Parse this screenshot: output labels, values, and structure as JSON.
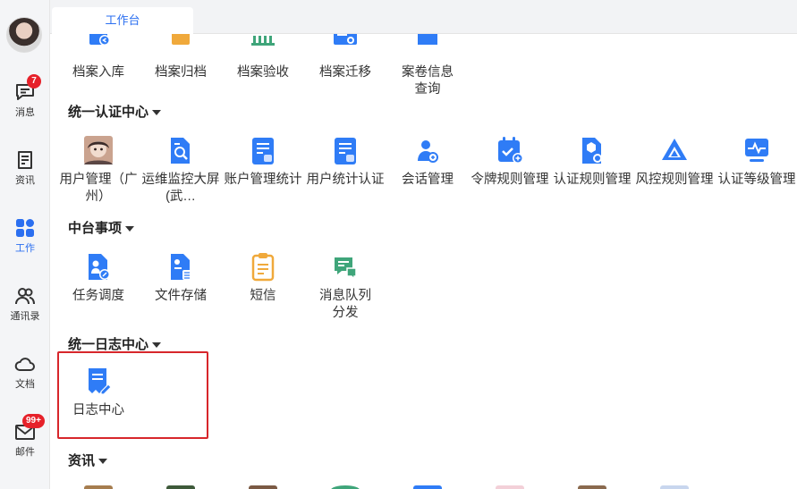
{
  "sidebar": {
    "items": [
      {
        "label": "消息",
        "icon": "message-icon",
        "badge": "7"
      },
      {
        "label": "资讯",
        "icon": "news-icon"
      },
      {
        "label": "工作",
        "icon": "apps-grid-icon"
      },
      {
        "label": "通讯录",
        "icon": "contacts-icon"
      },
      {
        "label": "文档",
        "icon": "cloud-docs-icon"
      },
      {
        "label": "邮件",
        "icon": "mail-icon",
        "badge": "99+"
      }
    ]
  },
  "tabs": [
    {
      "label": "工作台"
    }
  ],
  "top_row": [
    {
      "label": "档案入库",
      "icon": "archive-in-icon"
    },
    {
      "label": "档案归档",
      "icon": "archive-file-icon"
    },
    {
      "label": "档案验收",
      "icon": "archive-check-icon"
    },
    {
      "label": "档案迁移",
      "icon": "archive-move-icon"
    },
    {
      "label": "案卷信息查询",
      "icon": "archive-search-icon"
    }
  ],
  "sections": {
    "auth": {
      "title": "统一认证中心",
      "apps": [
        {
          "label": "用户管理（广州）",
          "icon": "user-avatar-icon"
        },
        {
          "label": "运维监控大屏(武…",
          "icon": "monitor-doc-icon"
        },
        {
          "label": "账户管理统计",
          "icon": "doc-stats-icon"
        },
        {
          "label": "用户统计认证",
          "icon": "doc-auth-icon"
        },
        {
          "label": "会话管理",
          "icon": "session-icon"
        },
        {
          "label": "令牌规则管理",
          "icon": "calendar-plus-icon"
        },
        {
          "label": "认证规则管理",
          "icon": "doc-gear-icon"
        },
        {
          "label": "风控规则管理",
          "icon": "triangle-icon"
        },
        {
          "label": "认证等级管理",
          "icon": "pulse-icon"
        }
      ]
    },
    "middle": {
      "title": "中台事项",
      "apps": [
        {
          "label": "任务调度",
          "icon": "task-dispatch-icon"
        },
        {
          "label": "文件存储",
          "icon": "file-storage-icon"
        },
        {
          "label": "短信",
          "icon": "sms-clipboard-icon"
        },
        {
          "label": "消息队列分发",
          "icon": "message-queue-icon"
        }
      ]
    },
    "logs": {
      "title": "统一日志中心",
      "apps": [
        {
          "label": "日志中心",
          "icon": "log-edit-icon"
        }
      ]
    },
    "news": {
      "title": "资讯"
    }
  },
  "colors": {
    "accent": "#2b6ff0",
    "highlight_border": "#d7262b",
    "badge": "#e6212a"
  }
}
